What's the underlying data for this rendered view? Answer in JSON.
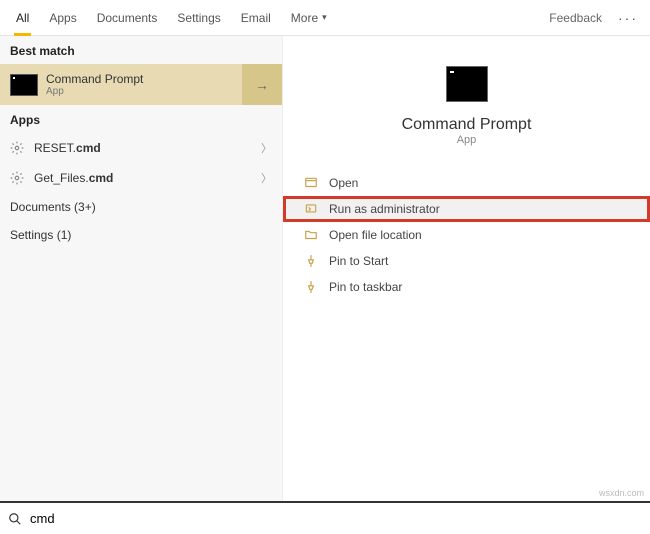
{
  "tabs": {
    "all": "All",
    "apps": "Apps",
    "documents": "Documents",
    "settings": "Settings",
    "email": "Email",
    "more": "More"
  },
  "feedback": "Feedback",
  "left": {
    "bestmatch_h": "Best match",
    "bestmatch": {
      "title": "Command Prompt",
      "sub": "App"
    },
    "apps_h": "Apps",
    "app1_pre": "RESET.",
    "app1_bold": "cmd",
    "app2_pre": "Get_Files.",
    "app2_bold": "cmd",
    "documents_h": "Documents (3+)",
    "settings_h": "Settings (1)"
  },
  "preview": {
    "title": "Command Prompt",
    "sub": "App"
  },
  "actions": {
    "open": "Open",
    "runadmin": "Run as administrator",
    "openloc": "Open file location",
    "pinstart": "Pin to Start",
    "pintaskbar": "Pin to taskbar"
  },
  "search": {
    "value": "cmd"
  },
  "watermark": "wsxdn.com"
}
